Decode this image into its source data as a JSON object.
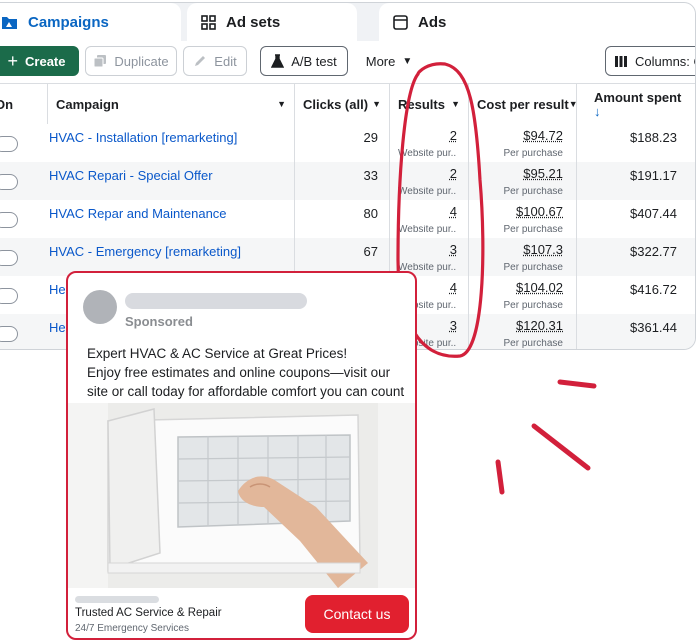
{
  "tabs": [
    {
      "label": "Campaigns",
      "icon": "folder-icon"
    },
    {
      "label": "Ad sets",
      "icon": "grid-icon"
    },
    {
      "label": "Ads",
      "icon": "ad-window-icon"
    }
  ],
  "toolbar": {
    "create_label": "Create",
    "duplicate_label": "Duplicate",
    "edit_label": "Edit",
    "ab_test_label": "A/B test",
    "more_label": "More",
    "columns_label": "Columns: Cu"
  },
  "table": {
    "headers": {
      "on": "On",
      "campaign": "Campaign",
      "clicks": "Clicks (all)",
      "results": "Results",
      "cost": "Cost per result",
      "spent": "Amount spent",
      "sort_arrow": "↓"
    },
    "rows": [
      {
        "name": "HVAC - Installation [remarketing]",
        "clicks": "29",
        "results": "2",
        "results_sub": "Website pur...",
        "cost": "$94.72",
        "cost_sub": "Per purchase",
        "spent": "$188.23"
      },
      {
        "name": "HVAC Repari - Special Offer",
        "clicks": "33",
        "results": "2",
        "results_sub": "Website pur...",
        "cost": "$95.21",
        "cost_sub": "Per purchase",
        "spent": "$191.17"
      },
      {
        "name": "HVAC Repar and Maintenance",
        "clicks": "80",
        "results": "4",
        "results_sub": "Website pur...",
        "cost": "$100.67",
        "cost_sub": "Per purchase",
        "spent": "$407.44"
      },
      {
        "name": "HVAC - Emergency [remarketing]",
        "clicks": "67",
        "results": "3",
        "results_sub": "Website pur...",
        "cost": "$107.3",
        "cost_sub": "Per purchase",
        "spent": "$322.77"
      },
      {
        "name": "Hea",
        "clicks": "",
        "results": "4",
        "results_sub": "Website pur...",
        "cost": "$104.02",
        "cost_sub": "Per purchase",
        "spent": "$416.72"
      },
      {
        "name": "Hea",
        "clicks": "",
        "results": "3",
        "results_sub": "Website pur...",
        "cost": "$120.31",
        "cost_sub": "Per purchase",
        "spent": "$361.44"
      }
    ]
  },
  "ad_preview": {
    "sponsored": "Sponsored",
    "copy_line1": "Expert HVAC & AC Service at Great Prices!",
    "copy_line2": "Enjoy free estimates and online coupons—visit our site or call today for affordable comfort you can count on!",
    "image_subject": "hand-cleaning-ac-unit",
    "headline": "Trusted AC Service & Repair",
    "subline": "24/7 Emergency Services",
    "cta_label": "Contact us"
  },
  "colors": {
    "accent_red": "#d2203b",
    "create_green": "#1b6b4a",
    "link_blue": "#0a58ca"
  }
}
